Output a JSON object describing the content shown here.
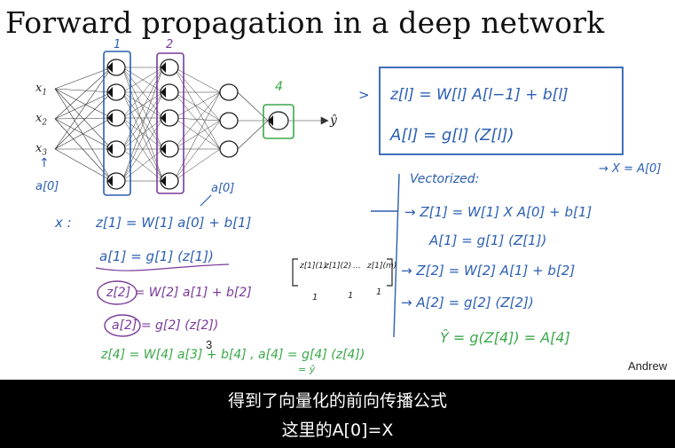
{
  "slide": {
    "title": "Forward propagation in a deep network",
    "inputs": [
      "x",
      "x",
      "x"
    ],
    "input_subscripts": [
      "1",
      "2",
      "3"
    ],
    "output_label": "ŷ",
    "page_number": "3",
    "author": "Andrew"
  },
  "annotations": {
    "layer_numbers": [
      "1",
      "2",
      "4"
    ],
    "input_a0": "a[0]",
    "net_a0": "a[0]",
    "boxed_eq1": "z[l] = W[l] A[l−1] + b[l]",
    "boxed_eq2": "A[l] = g[l] (Z[l])",
    "x_arrow": "→ X = A[0]",
    "vectorized": "Vectorized:",
    "vec_eqs": [
      "→ Z[1] = W[1] X A[0] + b[1]",
      "A[1] = g[1] (Z[1])",
      "→ Z[2] = W[2] A[1] + b[2]",
      "→ A[2] = g[2] (Z[2])"
    ],
    "yhat_eq": "Ŷ = g(Z[4]) = A[4]",
    "x_colon": "x :",
    "eq_z1": "z[1] = W[1] a[0] + b[1]",
    "eq_a1": "a[1] = g[1] (z[1])",
    "eq_z2": "z[2] = W[2] a[1] + b[2]",
    "eq_a2": "a[2] = g[2] (z[2])",
    "eq_z4": "z[4] = W[4] a[3] + b[4] ,  a[4] = g[4] (z[4])",
    "eq_eq_yhat": "= ŷ",
    "matrix_cols": [
      "z[1](1)",
      "z[1](2)",
      "...",
      "z[1](m)"
    ],
    "matrix_ones": [
      "1",
      "1",
      "1"
    ]
  },
  "subtitles": {
    "line1": "得到了向量化的前向传播公式",
    "line2": "这里的A[0]=X"
  },
  "colors": {
    "blue_ink": "#2b5fb3",
    "green_ink": "#3aa84a",
    "purple_ink": "#7a3a9a",
    "subtitle_bg": "#000000",
    "subtitle_text": "#ffffff"
  }
}
